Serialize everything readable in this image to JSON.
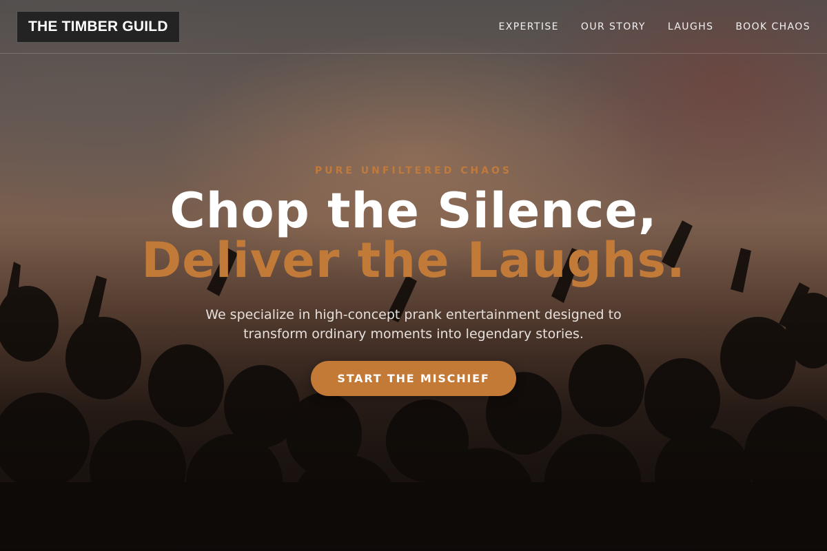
{
  "header": {
    "logo": "THE TIMBER GUILD",
    "nav": [
      {
        "label": "EXPERTISE"
      },
      {
        "label": "OUR STORY"
      },
      {
        "label": "LAUGHS"
      },
      {
        "label": "BOOK CHAOS"
      }
    ]
  },
  "hero": {
    "eyebrow": "PURE UNFILTERED CHAOS",
    "headline_line1": "Chop the Silence,",
    "headline_line2": "Deliver the Laughs.",
    "subtitle": "We specialize in high-concept prank entertainment designed to transform ordinary moments into legendary stories.",
    "cta_label": "START THE MISCHIEF"
  },
  "colors": {
    "accent": "#c47a37",
    "logo_bg": "#232323"
  }
}
